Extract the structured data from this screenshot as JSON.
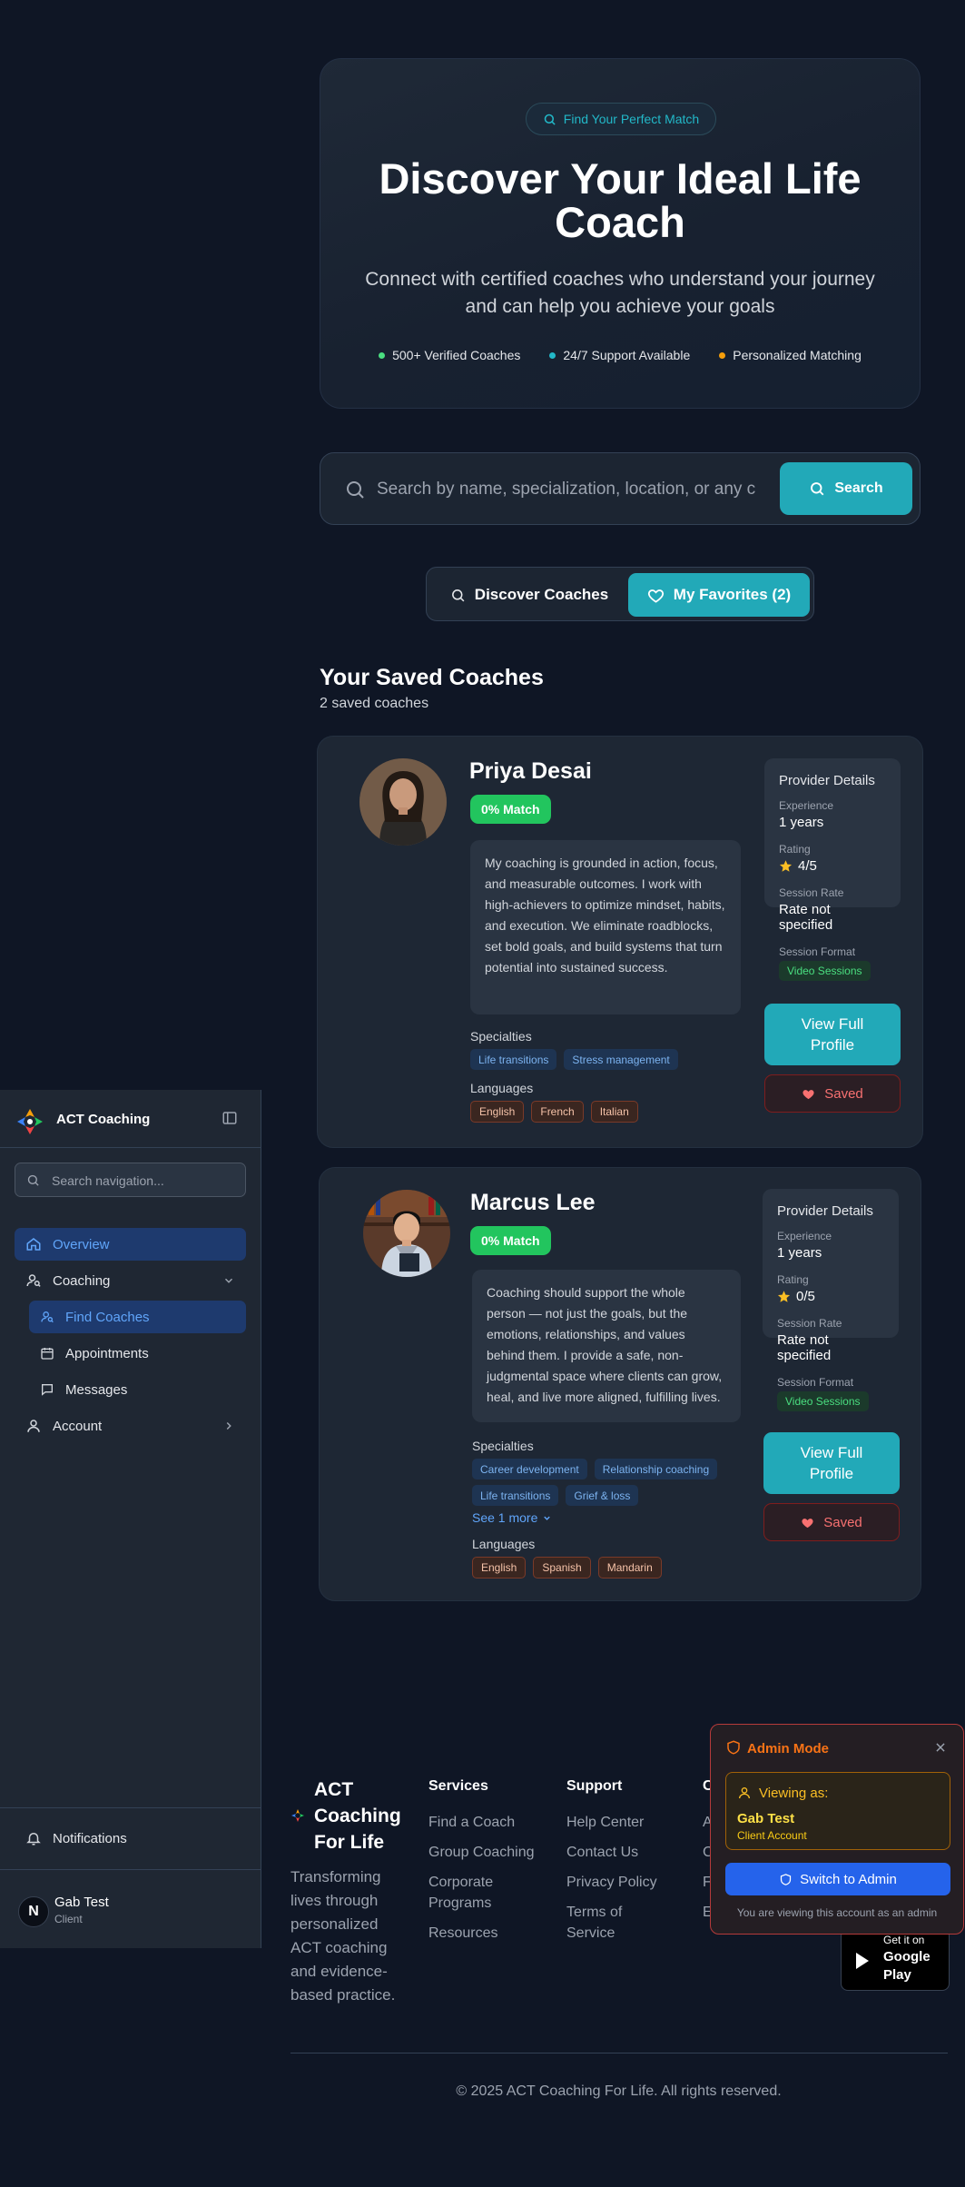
{
  "hero": {
    "badge": "Find Your Perfect Match",
    "title": "Discover Your Ideal Life Coach",
    "subtitle": "Connect with certified coaches who understand your journey and can help you achieve your goals",
    "features": [
      {
        "label": "500+ Verified Coaches",
        "color": "#4ade80"
      },
      {
        "label": "24/7 Support Available",
        "color": "#22b8c8"
      },
      {
        "label": "Personalized Matching",
        "color": "#f59e0b"
      }
    ]
  },
  "search": {
    "placeholder": "Search by name, specialization, location, or any criteria",
    "button_label": "Search"
  },
  "tabs": {
    "discover": "Discover Coaches",
    "favorites": "My Favorites (2)"
  },
  "saved": {
    "title": "Your Saved Coaches",
    "count": "2 saved coaches"
  },
  "coaches": [
    {
      "name": "Priya Desai",
      "match": "0% Match",
      "bio": "My coaching is grounded in action, focus, and measurable outcomes. I work with high-achievers to optimize mindset, habits, and execution. We eliminate roadblocks, set bold goals, and build systems that turn potential into sustained success.",
      "specialties_label": "Specialties",
      "specialties": [
        "Life transitions",
        "Stress management"
      ],
      "languages_label": "Languages",
      "languages": [
        "English",
        "French",
        "Italian"
      ],
      "details": {
        "title": "Provider Details",
        "experience_label": "Experience",
        "experience": "1 years",
        "rating_label": "Rating",
        "rating": "4/5",
        "rate_label": "Session Rate",
        "rate": "Rate not specified",
        "format_label": "Session Format",
        "format": "Video Sessions"
      },
      "view_label": "View Full Profile",
      "saved_label": "Saved"
    },
    {
      "name": "Marcus Lee",
      "match": "0% Match",
      "bio": "Coaching should support the whole person — not just the goals, but the emotions, relationships, and values behind them. I provide a safe, non-judgmental space where clients can grow, heal, and live more aligned, fulfilling lives.",
      "specialties_label": "Specialties",
      "specialties": [
        "Career development",
        "Relationship coaching",
        "Life transitions",
        "Grief & loss"
      ],
      "see_more": "See 1 more",
      "languages_label": "Languages",
      "languages": [
        "English",
        "Spanish",
        "Mandarin"
      ],
      "details": {
        "title": "Provider Details",
        "experience_label": "Experience",
        "experience": "1 years",
        "rating_label": "Rating",
        "rating": "0/5",
        "rate_label": "Session Rate",
        "rate": "Rate not specified",
        "format_label": "Session Format",
        "format": "Video Sessions"
      },
      "view_label": "View Full Profile",
      "saved_label": "Saved"
    }
  ],
  "sidebar": {
    "brand": "ACT Coaching",
    "search_placeholder": "Search navigation...",
    "items": [
      {
        "label": "Overview",
        "icon": "home-icon"
      },
      {
        "label": "Coaching",
        "icon": "user-search-icon"
      },
      {
        "label": "Find Coaches",
        "icon": "user-search-icon"
      },
      {
        "label": "Appointments",
        "icon": "calendar-icon"
      },
      {
        "label": "Messages",
        "icon": "message-icon"
      },
      {
        "label": "Account",
        "icon": "user-icon"
      }
    ],
    "notifications": "Notifications",
    "user": {
      "initial": "N",
      "name": "Gab Test",
      "role": "Client"
    }
  },
  "footer": {
    "brand": "ACT Coaching For Life",
    "description": "Transforming lives through personalized ACT coaching and evidence-based practice.",
    "services_title": "Services",
    "services": [
      "Find a Coach",
      "Group Coaching",
      "Corporate Programs",
      "Resources"
    ],
    "support_title": "Support",
    "support": [
      "Help Center",
      "Contact Us",
      "Privacy Policy",
      "Terms of Service"
    ],
    "partial_title": "C",
    "partial_links": [
      "A",
      "C",
      "F",
      "E"
    ],
    "gplay_small": "Get it on",
    "gplay_big": "Google Play",
    "copyright": "© 2025 ACT Coaching For Life. All rights reserved."
  },
  "admin": {
    "title": "Admin Mode",
    "viewing_label": "Viewing as:",
    "viewing_name": "Gab Test",
    "viewing_role": "Client Account",
    "switch_label": "Switch to Admin",
    "note": "You are viewing this account as an admin"
  }
}
